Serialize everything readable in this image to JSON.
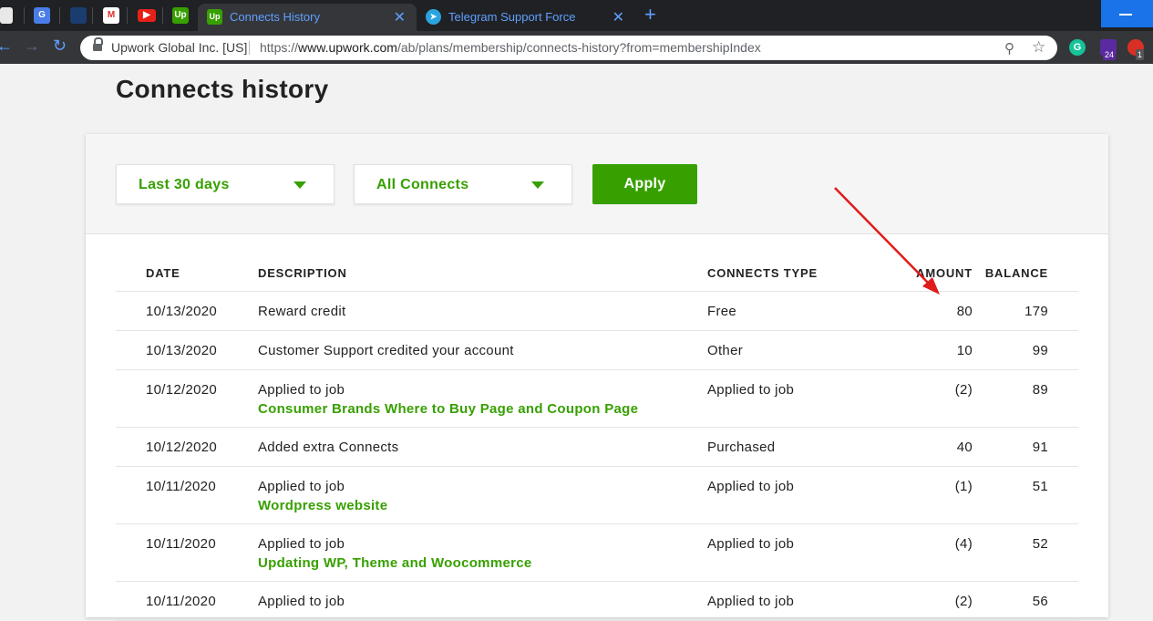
{
  "browser": {
    "tabs": [
      {
        "title": "Connects History",
        "favicon": "Up",
        "active": true
      },
      {
        "title": "Telegram Support Force",
        "favicon": "telegram-icon",
        "active": false
      }
    ],
    "pinned_tabs": [
      "chat-icon",
      "translate-icon",
      "bug-icon",
      "gmail-icon",
      "youtube-icon",
      "upwork-icon"
    ],
    "upwork_favicon_text": "Up",
    "site_name": "Upwork Global Inc. [US]",
    "url_prefix": "https://",
    "url_host": "www.upwork.com",
    "url_path": "/ab/plans/membership/connects-history?from=membershipIndex",
    "extensions": {
      "grammarly_letter": "G",
      "badge_purple": "24",
      "badge_red": "1"
    }
  },
  "page": {
    "title": "Connects history",
    "filters": {
      "period": "Last 30 days",
      "type": "All Connects",
      "apply_label": "Apply"
    },
    "columns": {
      "date": "DATE",
      "description": "DESCRIPTION",
      "type": "CONNECTS TYPE",
      "amount": "AMOUNT",
      "balance": "BALANCE"
    },
    "rows": [
      {
        "date": "10/13/2020",
        "description": "Reward credit",
        "job": "",
        "type": "Free",
        "amount": "80",
        "balance": "179"
      },
      {
        "date": "10/13/2020",
        "description": "Customer Support credited your account",
        "job": "",
        "type": "Other",
        "amount": "10",
        "balance": "99"
      },
      {
        "date": "10/12/2020",
        "description": "Applied to job",
        "job": "Consumer Brands Where to Buy Page and Coupon Page",
        "type": "Applied to job",
        "amount": "(2)",
        "balance": "89"
      },
      {
        "date": "10/12/2020",
        "description": "Added extra Connects",
        "job": "",
        "type": "Purchased",
        "amount": "40",
        "balance": "91"
      },
      {
        "date": "10/11/2020",
        "description": "Applied to job",
        "job": "Wordpress website",
        "type": "Applied to job",
        "amount": "(1)",
        "balance": "51"
      },
      {
        "date": "10/11/2020",
        "description": "Applied to job",
        "job": "Updating WP, Theme and Woocommerce",
        "type": "Applied to job",
        "amount": "(4)",
        "balance": "52"
      },
      {
        "date": "10/11/2020",
        "description": "Applied to job",
        "job": "",
        "type": "Applied to job",
        "amount": "(2)",
        "balance": "56"
      }
    ]
  },
  "colors": {
    "brand_green": "#37a000",
    "annotation_arrow": "#e01b1b",
    "chrome_dark": "#202124",
    "link_blue": "#5ea0ff"
  }
}
